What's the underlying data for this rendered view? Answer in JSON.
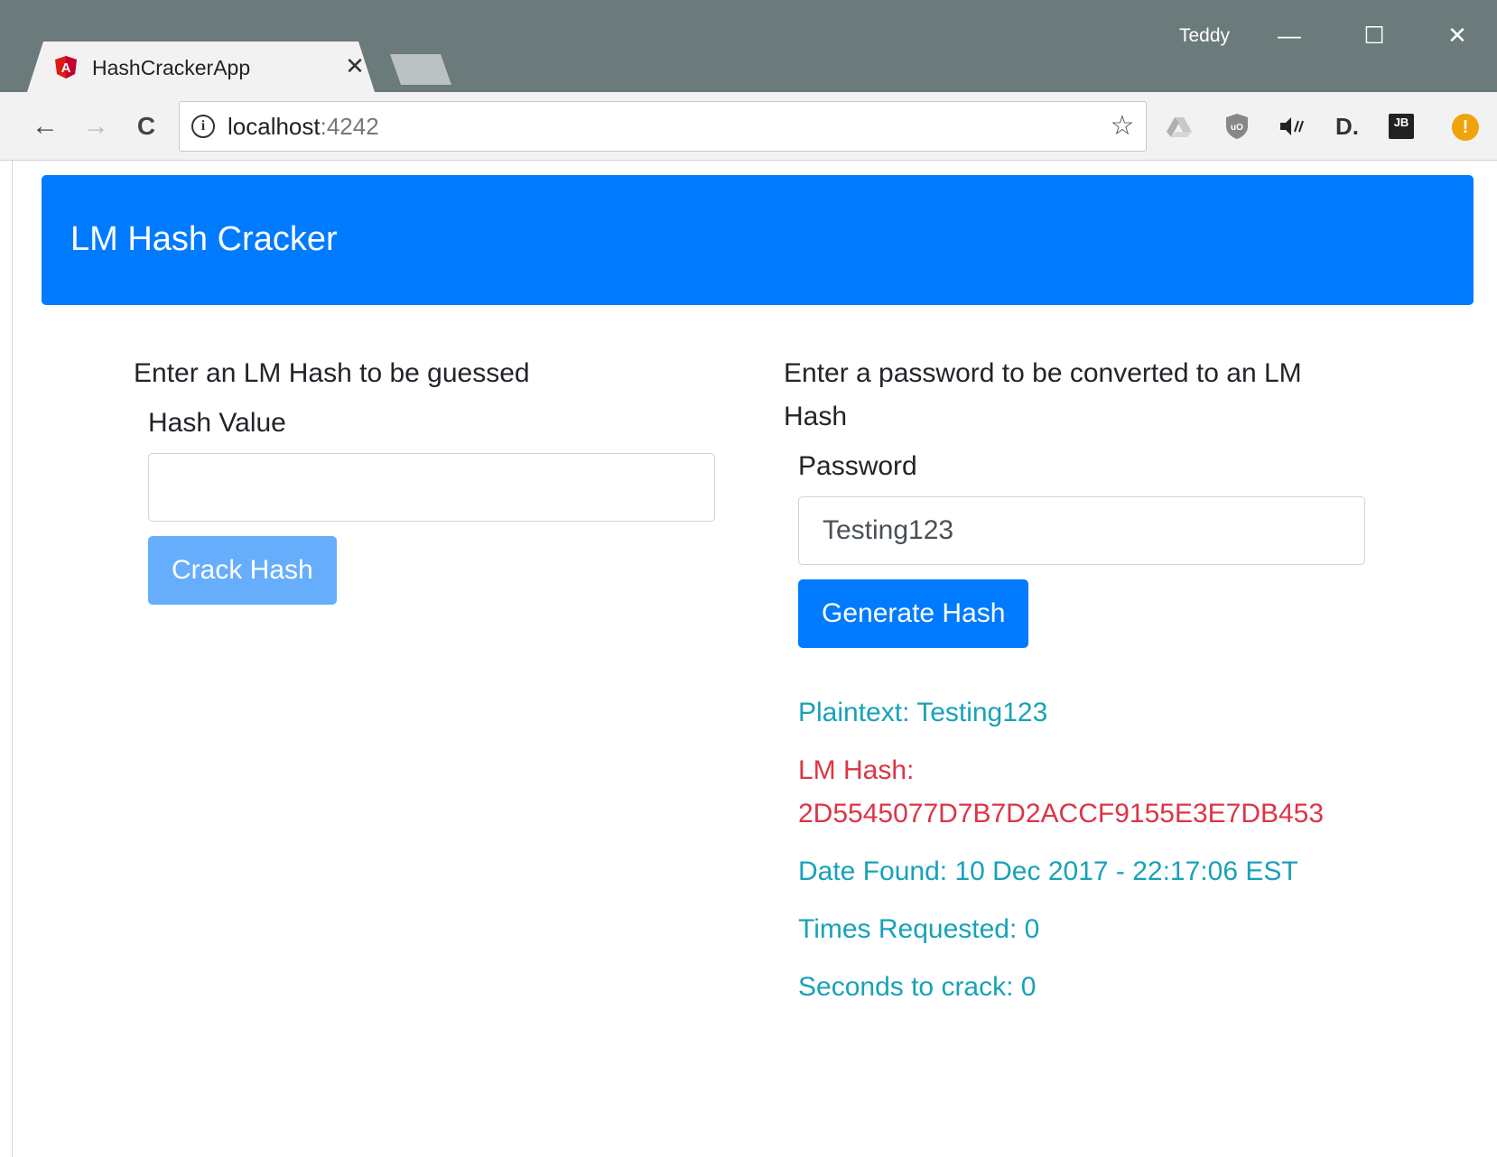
{
  "browser": {
    "tab_title": "HashCrackerApp",
    "tab_close": "✕",
    "profile_name": "Teddy",
    "window_controls": {
      "minimize": "—",
      "maximize": "☐",
      "close": "✕"
    },
    "nav": {
      "back": "←",
      "forward": "→",
      "reload": "C"
    },
    "url_host": "localhost",
    "url_port": ":4242",
    "info": "i",
    "star": "☆",
    "extensions": [
      "drive-icon",
      "ublock-icon",
      "audio-icon",
      "d-icon",
      "jetbrains-icon",
      "alert-icon"
    ],
    "extension_labels": {
      "d": "D.",
      "jb": "JB",
      "alert": "!"
    }
  },
  "navbar": {
    "brand": "LM Hash Cracker"
  },
  "left": {
    "title": "Enter an LM Hash to be guessed",
    "label": "Hash Value",
    "value": "",
    "button": "Crack Hash"
  },
  "right": {
    "title": "Enter a password to be converted to an LM Hash",
    "label": "Password",
    "value": "Testing123",
    "button": "Generate Hash",
    "results": {
      "plaintext": "Plaintext: Testing123",
      "lm_hash_label": "LM Hash:",
      "lm_hash_value": "2D5545077D7B7D2ACCF9155E3E7DB453",
      "date_found": "Date Found: 10 Dec 2017 - 22:17:06 EST",
      "times_requested": "Times Requested: 0",
      "seconds_to_crack": "Seconds to crack: 0"
    }
  },
  "colors": {
    "primary": "#007bff",
    "info": "#17a2b8",
    "danger": "#dc3545",
    "chrome": "#6b7a7b"
  }
}
